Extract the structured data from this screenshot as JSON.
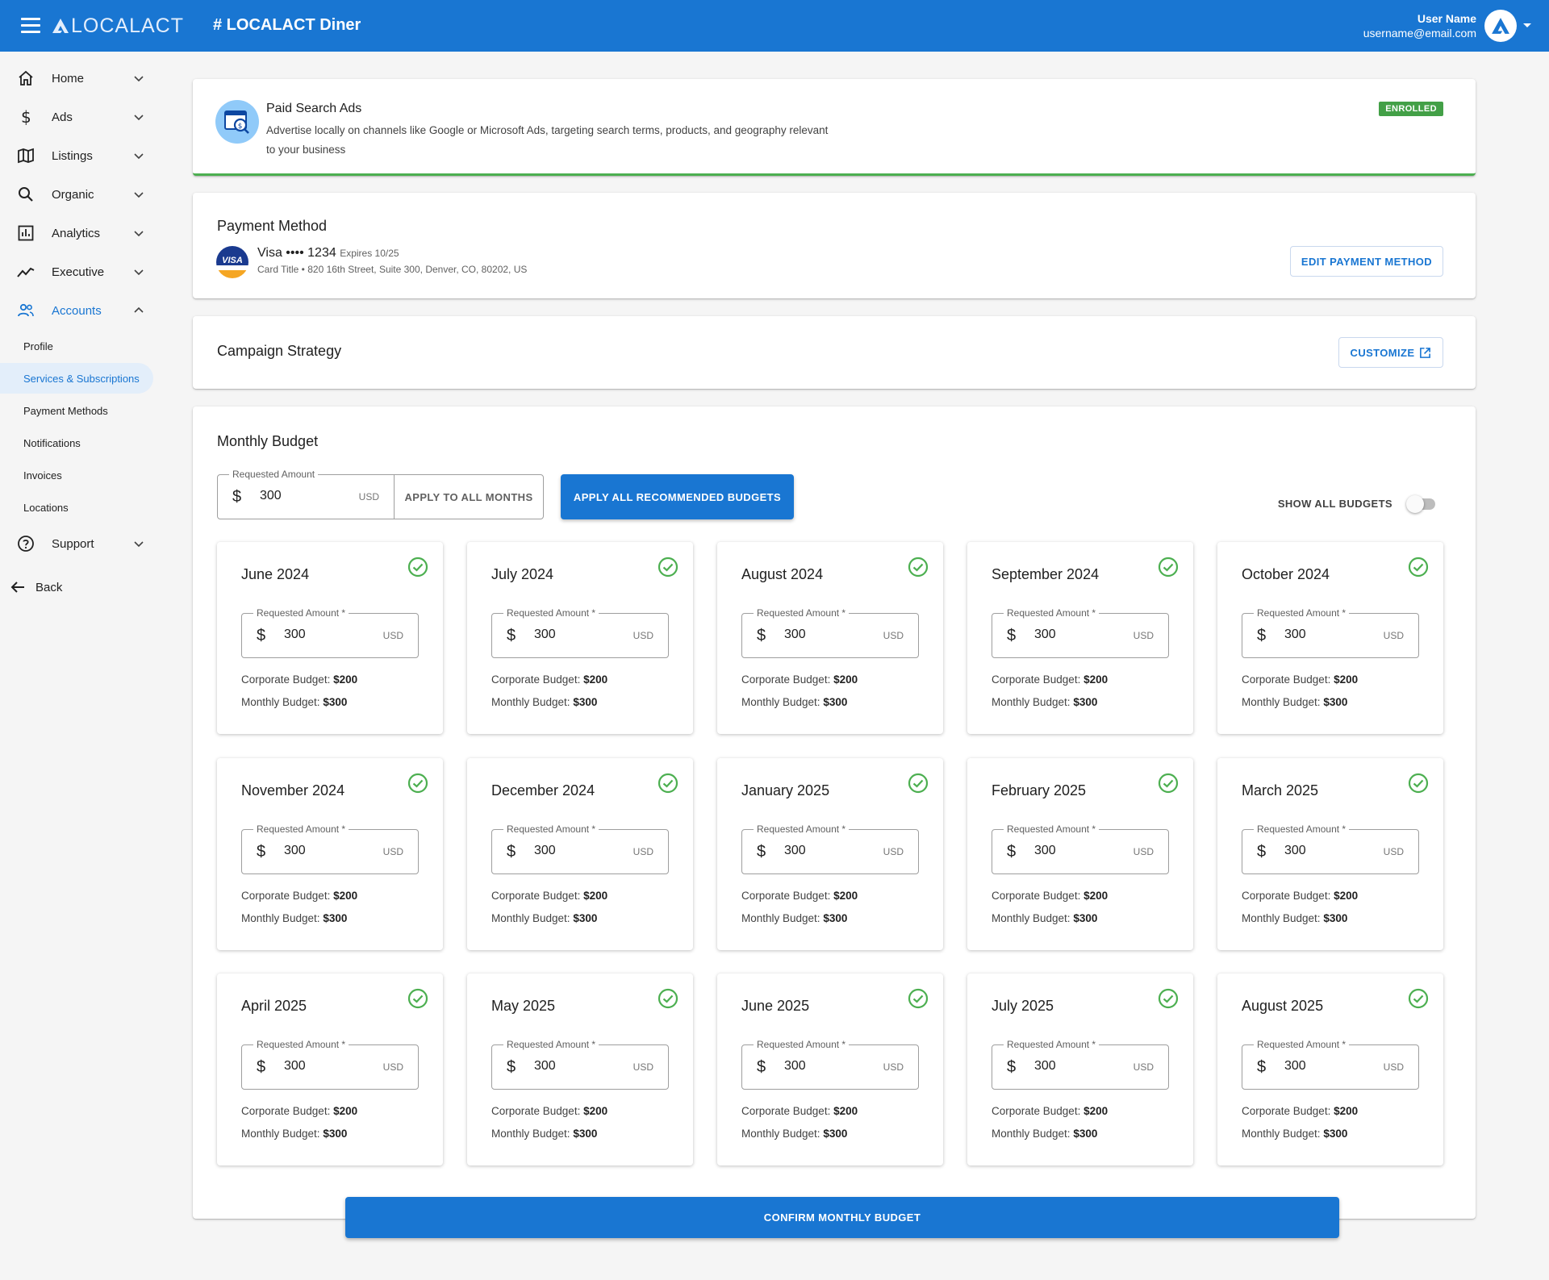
{
  "header": {
    "logo_text": "LOCALACT",
    "title": "# LOCALACT Diner",
    "user_name": "User Name",
    "user_email": "username@email.com"
  },
  "sidebar": {
    "items": [
      {
        "label": "Home",
        "icon": "home-icon"
      },
      {
        "label": "Ads",
        "icon": "dollar-icon"
      },
      {
        "label": "Listings",
        "icon": "map-icon"
      },
      {
        "label": "Organic",
        "icon": "search-icon"
      },
      {
        "label": "Analytics",
        "icon": "bar-chart-icon"
      },
      {
        "label": "Executive",
        "icon": "trend-icon"
      },
      {
        "label": "Accounts",
        "icon": "people-icon"
      }
    ],
    "sub_items": [
      "Profile",
      "Services & Subscriptions",
      "Payment Methods",
      "Notifications",
      "Invoices",
      "Locations"
    ],
    "support_label": "Support",
    "back_label": "Back"
  },
  "service": {
    "title": "Paid Search Ads",
    "description": "Advertise locally on channels like Google or Microsoft Ads, targeting search terms, products, and geography relevant to your business",
    "status": "ENROLLED"
  },
  "payment": {
    "heading": "Payment Method",
    "brand": "Visa",
    "masked": "•••• 1234",
    "expires": "Expires 10/25",
    "address": "Card Title • 820 16th Street, Suite 300, Denver, CO, 80202, US",
    "logo_text": "VISA",
    "edit_label": "EDIT PAYMENT METHOD"
  },
  "strategy": {
    "heading": "Campaign Strategy",
    "customize_label": "CUSTOMIZE"
  },
  "budget": {
    "heading": "Monthly Budget",
    "field_label": "Requested Amount",
    "currency_symbol": "$",
    "value": "300",
    "unit": "USD",
    "apply_months_label": "APPLY TO ALL MONTHS",
    "apply_recommended_label": "APPLY ALL RECOMMENDED BUDGETS",
    "show_all_label": "SHOW ALL BUDGETS",
    "show_all_on": false,
    "month_field_label": "Requested Amount *",
    "corporate_label": "Corporate Budget:",
    "monthly_label": "Monthly Budget:",
    "months": [
      {
        "name": "June 2024",
        "amount": "300",
        "corporate": "$200",
        "monthly": "$300"
      },
      {
        "name": "July 2024",
        "amount": "300",
        "corporate": "$200",
        "monthly": "$300"
      },
      {
        "name": "August 2024",
        "amount": "300",
        "corporate": "$200",
        "monthly": "$300"
      },
      {
        "name": "September 2024",
        "amount": "300",
        "corporate": "$200",
        "monthly": "$300"
      },
      {
        "name": "October 2024",
        "amount": "300",
        "corporate": "$200",
        "monthly": "$300"
      },
      {
        "name": "November 2024",
        "amount": "300",
        "corporate": "$200",
        "monthly": "$300"
      },
      {
        "name": "December 2024",
        "amount": "300",
        "corporate": "$200",
        "monthly": "$300"
      },
      {
        "name": "January 2025",
        "amount": "300",
        "corporate": "$200",
        "monthly": "$300"
      },
      {
        "name": "February 2025",
        "amount": "300",
        "corporate": "$200",
        "monthly": "$300"
      },
      {
        "name": "March 2025",
        "amount": "300",
        "corporate": "$200",
        "monthly": "$300"
      },
      {
        "name": "April 2025",
        "amount": "300",
        "corporate": "$200",
        "monthly": "$300"
      },
      {
        "name": "May 2025",
        "amount": "300",
        "corporate": "$200",
        "monthly": "$300"
      },
      {
        "name": "June 2025",
        "amount": "300",
        "corporate": "$200",
        "monthly": "$300"
      },
      {
        "name": "July 2025",
        "amount": "300",
        "corporate": "$200",
        "monthly": "$300"
      },
      {
        "name": "August 2025",
        "amount": "300",
        "corporate": "$200",
        "monthly": "$300"
      }
    ],
    "confirm_label": "CONFIRM MONTHLY BUDGET"
  },
  "colors": {
    "primary": "#1976d2",
    "success": "#43a047",
    "check": "#4caf50",
    "active_bg": "#e3eefa"
  }
}
